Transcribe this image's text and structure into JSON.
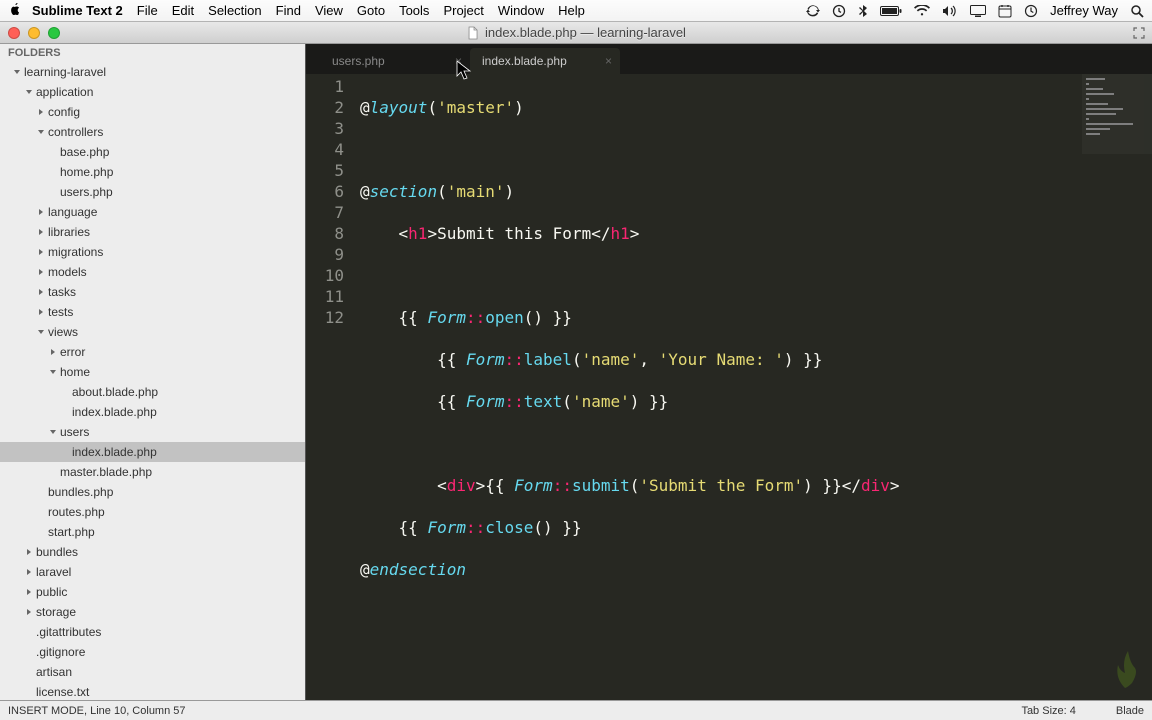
{
  "menubar": {
    "app_name": "Sublime Text 2",
    "items": [
      "File",
      "Edit",
      "Selection",
      "Find",
      "View",
      "Goto",
      "Tools",
      "Project",
      "Window",
      "Help"
    ],
    "user": "Jeffrey Way"
  },
  "window": {
    "title": "index.blade.php — learning-laravel"
  },
  "sidebar": {
    "header": "FOLDERS",
    "tree": [
      {
        "indent": 1,
        "arrow": "down",
        "label": "learning-laravel"
      },
      {
        "indent": 2,
        "arrow": "down",
        "label": "application"
      },
      {
        "indent": 3,
        "arrow": "right",
        "label": "config"
      },
      {
        "indent": 3,
        "arrow": "down",
        "label": "controllers"
      },
      {
        "indent": 4,
        "arrow": "",
        "label": "base.php"
      },
      {
        "indent": 4,
        "arrow": "",
        "label": "home.php"
      },
      {
        "indent": 4,
        "arrow": "",
        "label": "users.php"
      },
      {
        "indent": 3,
        "arrow": "right",
        "label": "language"
      },
      {
        "indent": 3,
        "arrow": "right",
        "label": "libraries"
      },
      {
        "indent": 3,
        "arrow": "right",
        "label": "migrations"
      },
      {
        "indent": 3,
        "arrow": "right",
        "label": "models"
      },
      {
        "indent": 3,
        "arrow": "right",
        "label": "tasks"
      },
      {
        "indent": 3,
        "arrow": "right",
        "label": "tests"
      },
      {
        "indent": 3,
        "arrow": "down",
        "label": "views"
      },
      {
        "indent": 4,
        "arrow": "right",
        "label": "error"
      },
      {
        "indent": 4,
        "arrow": "down",
        "label": "home"
      },
      {
        "indent": 5,
        "arrow": "",
        "label": "about.blade.php"
      },
      {
        "indent": 5,
        "arrow": "",
        "label": "index.blade.php"
      },
      {
        "indent": 4,
        "arrow": "down",
        "label": "users"
      },
      {
        "indent": 5,
        "arrow": "",
        "label": "index.blade.php",
        "selected": true
      },
      {
        "indent": 4,
        "arrow": "",
        "label": "master.blade.php"
      },
      {
        "indent": 3,
        "arrow": "",
        "label": "bundles.php"
      },
      {
        "indent": 3,
        "arrow": "",
        "label": "routes.php"
      },
      {
        "indent": 3,
        "arrow": "",
        "label": "start.php"
      },
      {
        "indent": 2,
        "arrow": "right",
        "label": "bundles"
      },
      {
        "indent": 2,
        "arrow": "right",
        "label": "laravel"
      },
      {
        "indent": 2,
        "arrow": "right",
        "label": "public"
      },
      {
        "indent": 2,
        "arrow": "right",
        "label": "storage"
      },
      {
        "indent": 2,
        "arrow": "",
        "label": ".gitattributes"
      },
      {
        "indent": 2,
        "arrow": "",
        "label": ".gitignore"
      },
      {
        "indent": 2,
        "arrow": "",
        "label": "artisan"
      },
      {
        "indent": 2,
        "arrow": "",
        "label": "license.txt"
      }
    ]
  },
  "tabs": [
    {
      "label": "users.php",
      "active": false
    },
    {
      "label": "index.blade.php",
      "active": true
    }
  ],
  "editor": {
    "line_count": 12
  },
  "statusbar": {
    "left": "INSERT MODE, Line 10, Column 57",
    "tab_size": "Tab Size: 4",
    "syntax": "Blade"
  }
}
